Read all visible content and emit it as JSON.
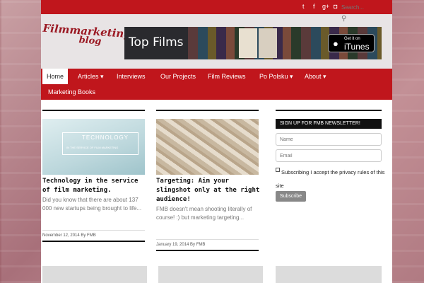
{
  "topbar": {
    "social": [
      {
        "icon": "twitter-icon",
        "glyph": "t"
      },
      {
        "icon": "facebook-icon",
        "glyph": "f"
      },
      {
        "icon": "google-plus-icon",
        "glyph": "g+"
      },
      {
        "icon": "instagram-icon",
        "glyph": "◘"
      }
    ],
    "search_placeholder": "Search..."
  },
  "header": {
    "logo_line1": "Filmmarketing",
    "logo_line2": "blog",
    "banner_title": "Top Films",
    "itunes_small": "Get it on",
    "itunes_big": "iTunes"
  },
  "nav": {
    "items": [
      {
        "label": "Home",
        "active": true
      },
      {
        "label": "Articles ▾"
      },
      {
        "label": "Interviews"
      },
      {
        "label": "Our Projects"
      },
      {
        "label": "Film Reviews"
      },
      {
        "label": "Po Polsku ▾"
      },
      {
        "label": "About ▾"
      },
      {
        "label": "Marketing Books"
      }
    ]
  },
  "posts": [
    {
      "image_title": "TECHNOLOGY",
      "image_subtitle": "IN THE SERVICE OF FILM MARKETING",
      "title": "Technology in the service of film marketing.",
      "excerpt": "Did you know that there are about 137 000 new startups being brought to life...",
      "meta": "November 12, 2014 By FMB"
    },
    {
      "title": "Targeting: Aim your slingshot only at the right audience!",
      "excerpt": "FMB doesn't mean shooting literally of course! :) but marketing targeting...",
      "meta": "January 19, 2014 By FMB"
    }
  ],
  "newsletter": {
    "heading": "SIGN UP FOR FMB NEWSLETTER!",
    "name_placeholder": "Name",
    "email_placeholder": "Email",
    "privacy": "Subscribing I accept the privacy rules of this site",
    "button": "Subscribe"
  },
  "colors": {
    "brand": "#c0161c",
    "header_bg": "#e8e4e5"
  }
}
